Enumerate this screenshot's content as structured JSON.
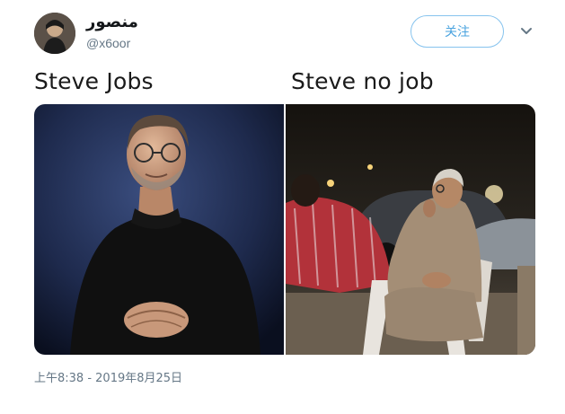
{
  "author": {
    "display_name": "منصور",
    "handle": "@x6oor"
  },
  "follow_button": {
    "label": "关注"
  },
  "captions": {
    "left": "Steve Jobs",
    "right": "Steve no job"
  },
  "timestamp": "上午8:38 - 2019年8月25日",
  "icons": {
    "avatar": "avatar-photo",
    "menu": "chevron-down-icon"
  },
  "colors": {
    "follow_accent": "#4aa3df",
    "muted_text": "#657786"
  }
}
